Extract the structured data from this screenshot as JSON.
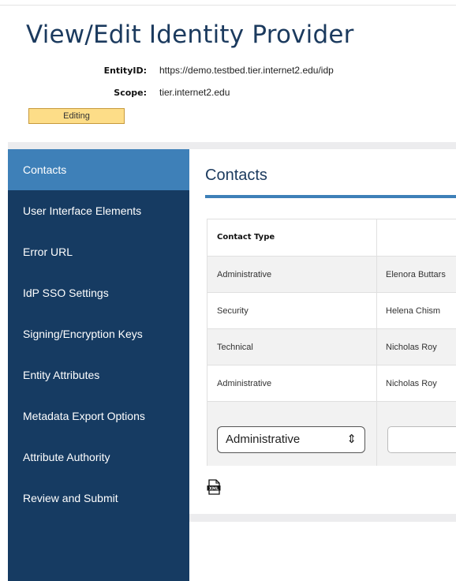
{
  "page": {
    "title": "View/Edit Identity Provider"
  },
  "meta": {
    "entity_id_label": "EntityID:",
    "entity_id_value": "https://demo.testbed.tier.internet2.edu/idp",
    "scope_label": "Scope:",
    "scope_value": "tier.internet2.edu"
  },
  "status_badge": "Editing",
  "sidebar": {
    "items": [
      {
        "label": "Contacts",
        "active": true
      },
      {
        "label": "User Interface Elements"
      },
      {
        "label": "Error URL"
      },
      {
        "label": "IdP SSO Settings"
      },
      {
        "label": "Signing/Encryption Keys"
      },
      {
        "label": "Entity Attributes"
      },
      {
        "label": "Metadata Export Options"
      },
      {
        "label": "Attribute Authority"
      },
      {
        "label": "Review and Submit"
      }
    ]
  },
  "contacts": {
    "section_title": "Contacts",
    "columns": [
      "Contact Type",
      ""
    ],
    "rows": [
      {
        "type": "Administrative",
        "name": "Elenora Buttars"
      },
      {
        "type": "Security",
        "name": "Helena Chism"
      },
      {
        "type": "Technical",
        "name": "Nicholas Roy"
      },
      {
        "type": "Administrative",
        "name": "Nicholas Roy"
      }
    ],
    "new_contact_type": "Administrative",
    "new_contact_name": ""
  },
  "icons": {
    "select_arrows": "up-down-chevron-icon",
    "xml": "xml-file-icon"
  },
  "colors": {
    "sidebar_bg": "#163b62",
    "sidebar_active": "#3e80b8",
    "title": "#1b3a5e",
    "badge_bg": "#fddd88"
  }
}
